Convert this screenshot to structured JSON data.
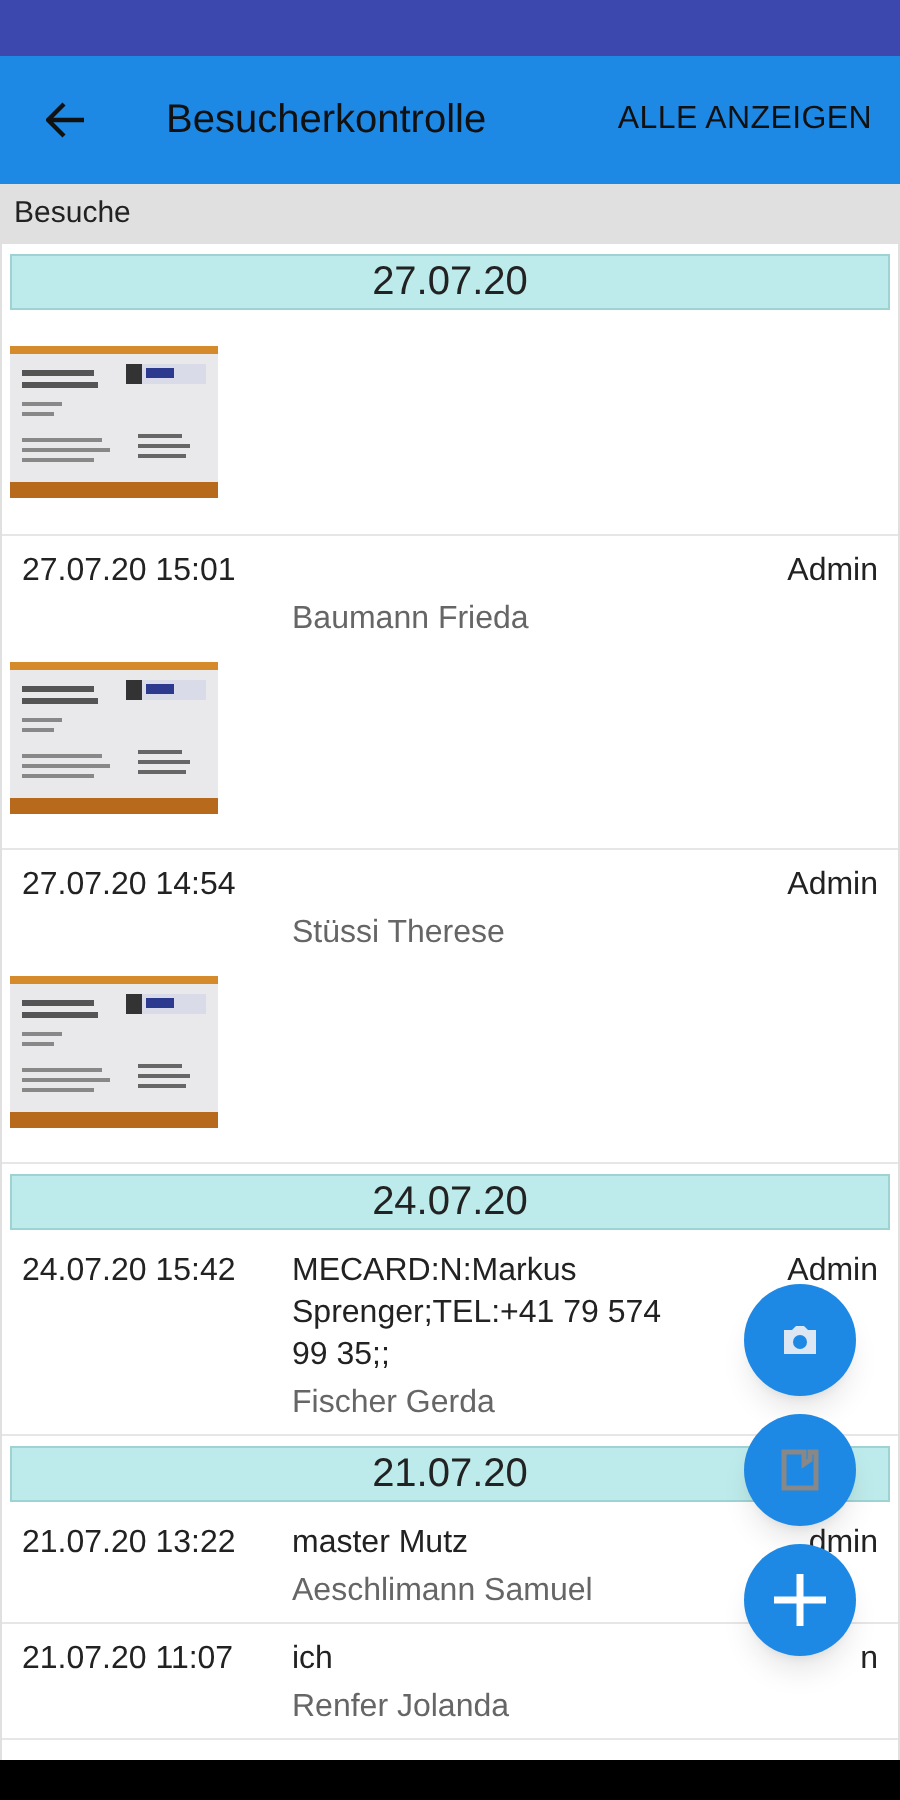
{
  "app_bar": {
    "title": "Besucherkontrolle",
    "action": "ALLE ANZEIGEN"
  },
  "subheader": "Besuche",
  "groups": [
    {
      "date": "27.07.20",
      "entries": [
        {
          "has_photo": true
        },
        {
          "time": "27.07.20 15:01",
          "user": "Admin",
          "name": "Baumann Frieda",
          "has_photo": true
        },
        {
          "time": "27.07.20 14:54",
          "user": "Admin",
          "name": "Stüssi Therese",
          "has_photo": true
        }
      ]
    },
    {
      "date": "24.07.20",
      "entries": [
        {
          "time": "24.07.20 15:42",
          "note": "MECARD:N:Markus Sprenger;TEL:+41 79 574 99 35;;",
          "user": "Admin",
          "name": "Fischer Gerda"
        }
      ]
    },
    {
      "date": "21.07.20",
      "entries": [
        {
          "time": "21.07.20 13:22",
          "note": "master Mutz",
          "user": "dmin",
          "name": "Aeschlimann Samuel"
        },
        {
          "time": "21.07.20 11:07",
          "note": "ich",
          "user": "n",
          "name": "Renfer Jolanda"
        }
      ]
    }
  ],
  "fabs": [
    {
      "kind": "camera"
    },
    {
      "kind": "document"
    },
    {
      "kind": "add"
    }
  ]
}
